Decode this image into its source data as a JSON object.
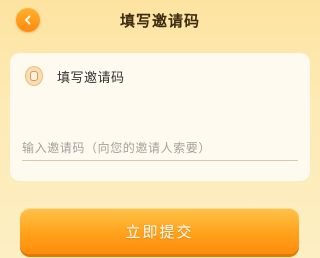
{
  "header": {
    "title": "填写邀请码",
    "back_icon": "chevron-left-icon"
  },
  "card": {
    "label": "填写邀请码",
    "icon": "coin-icon",
    "input_value": "",
    "input_placeholder": "输入邀请码（向您的邀请人索要）"
  },
  "submit": {
    "label": "立即提交"
  },
  "colors": {
    "accent": "#ff9a17",
    "background": "#fde8b0",
    "card": "#fffaf0"
  }
}
